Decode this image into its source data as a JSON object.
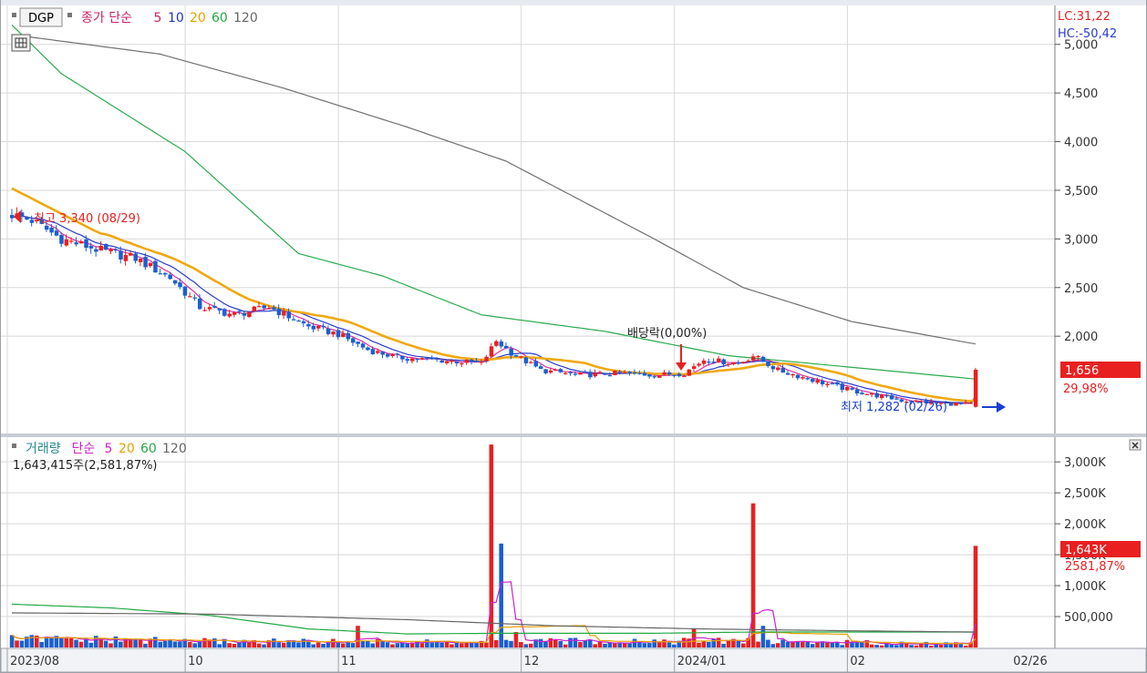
{
  "header": {
    "code": "DGP",
    "price_legend": [
      {
        "text": "종가 단순",
        "color": "#cc2266"
      },
      {
        "text": "5",
        "color": "#cc2266"
      },
      {
        "text": "10",
        "color": "#2233cc"
      },
      {
        "text": "20",
        "color": "#e8a000"
      },
      {
        "text": "60",
        "color": "#22aa44"
      },
      {
        "text": "120",
        "color": "#666666"
      }
    ],
    "lc": "LC:31,22",
    "hc": "HC:-50,42"
  },
  "volume_header": {
    "legend": [
      {
        "text": "거래량",
        "color": "#2a8a8a"
      },
      {
        "text": "단순",
        "color": "#cc22cc"
      },
      {
        "text": "5",
        "color": "#cc22cc"
      },
      {
        "text": "20",
        "color": "#e8a000"
      },
      {
        "text": "60",
        "color": "#22aa44"
      },
      {
        "text": "120",
        "color": "#666666"
      }
    ],
    "summary": "1,643,415주(2,581,87%)"
  },
  "annotations": {
    "high": "최고 3,340 (08/29)",
    "low": "최저 1,282 (02/26)",
    "ex_dividend": "배당락(0,00%)"
  },
  "badges": {
    "price": "1,656",
    "price_change": "29,98%",
    "volume": "1,643K",
    "volume_change": "2581,87%"
  },
  "colors": {
    "up": "#e82020",
    "down": "#1a5fd0",
    "ma5": "#e0309a",
    "ma10": "#2b3ccc",
    "ma20": "#f0a810",
    "ma60": "#2aaa50",
    "ma120": "#707070",
    "grid": "#d8d8d8",
    "badge": "#e82020"
  },
  "chart_data": [
    {
      "type": "candlestick",
      "title": "DGP",
      "y_ticks": [
        "5,000",
        "4,500",
        "4,000",
        "3,500",
        "3,000",
        "2,500",
        "2,000"
      ],
      "y_tick_values": [
        5000,
        4500,
        4000,
        3500,
        3000,
        2500,
        2000
      ],
      "ylim": [
        1000,
        5400
      ],
      "x_labels": [
        "2023/08",
        "10",
        "11",
        "12",
        "2024/01",
        "02",
        "02/26"
      ],
      "x_label_index": [
        0,
        36,
        67,
        104,
        135,
        170,
        203
      ],
      "n_bars": 195,
      "keypoints_close": [
        [
          0,
          3250
        ],
        [
          4,
          3190
        ],
        [
          10,
          3000
        ],
        [
          18,
          2880
        ],
        [
          25,
          2800
        ],
        [
          32,
          2600
        ],
        [
          38,
          2300
        ],
        [
          45,
          2220
        ],
        [
          52,
          2300
        ],
        [
          60,
          2100
        ],
        [
          66,
          2020
        ],
        [
          72,
          1860
        ],
        [
          78,
          1780
        ],
        [
          84,
          1760
        ],
        [
          90,
          1740
        ],
        [
          95,
          1720
        ],
        [
          98,
          1950
        ],
        [
          101,
          1830
        ],
        [
          107,
          1650
        ],
        [
          115,
          1600
        ],
        [
          123,
          1620
        ],
        [
          130,
          1600
        ],
        [
          136,
          1620
        ],
        [
          140,
          1760
        ],
        [
          147,
          1720
        ],
        [
          150,
          1800
        ],
        [
          155,
          1650
        ],
        [
          162,
          1550
        ],
        [
          170,
          1440
        ],
        [
          180,
          1340
        ],
        [
          188,
          1310
        ],
        [
          194,
          1300
        ]
      ],
      "last_bar": {
        "close": 1656,
        "prev_close": 1274
      },
      "high": {
        "value": 3340,
        "date": "08/29"
      },
      "low": {
        "value": 1282,
        "date": "02/26"
      },
      "moving_averages": [
        {
          "period": 5,
          "color": "#e0309a"
        },
        {
          "period": 10,
          "color": "#2b3ccc"
        },
        {
          "period": 20,
          "color": "#f0a810"
        },
        {
          "period": 60,
          "color": "#2aaa50",
          "keypoints": [
            [
              0,
              5200
            ],
            [
              10,
              4700
            ],
            [
              35,
              3900
            ],
            [
              58,
              2850
            ],
            [
              75,
              2620
            ],
            [
              95,
              2220
            ],
            [
              120,
              2050
            ],
            [
              145,
              1800
            ],
            [
              170,
              1680
            ],
            [
              195,
              1560
            ]
          ]
        },
        {
          "period": 120,
          "color": "#707070",
          "keypoints": [
            [
              0,
              5100
            ],
            [
              30,
              4900
            ],
            [
              55,
              4550
            ],
            [
              80,
              4150
            ],
            [
              100,
              3800
            ],
            [
              130,
              3000
            ],
            [
              148,
              2500
            ],
            [
              170,
              2150
            ],
            [
              195,
              1920
            ]
          ]
        }
      ]
    },
    {
      "type": "bar",
      "title": "거래량",
      "y_ticks": [
        "3,000K",
        "2,500K",
        "2,000K",
        "1,500K",
        "1,000K",
        "500,000"
      ],
      "y_tick_values": [
        3000,
        2500,
        2000,
        1500,
        1000,
        500
      ],
      "ylim": [
        0,
        3400
      ],
      "unit": "K",
      "keypoints_volume": [
        [
          0,
          140
        ],
        [
          20,
          120
        ],
        [
          40,
          100
        ],
        [
          70,
          90
        ],
        [
          95,
          80
        ],
        [
          120,
          110
        ],
        [
          150,
          100
        ],
        [
          180,
          70
        ],
        [
          194,
          60
        ]
      ],
      "spikes": [
        [
          70,
          350,
          "up"
        ],
        [
          97,
          3280,
          "up"
        ],
        [
          99,
          1680,
          "down"
        ],
        [
          102,
          250,
          "up"
        ],
        [
          138,
          300,
          "up"
        ],
        [
          150,
          2330,
          "up"
        ],
        [
          152,
          350,
          "down"
        ],
        [
          195,
          1643,
          "up"
        ]
      ],
      "moving_averages": [
        {
          "period": 5,
          "color": "#cc22cc"
        },
        {
          "period": 20,
          "color": "#e8a000"
        },
        {
          "period": 60,
          "color": "#22aa44",
          "keypoints": [
            [
              0,
              700
            ],
            [
              20,
              640
            ],
            [
              40,
              520
            ],
            [
              60,
              300
            ],
            [
              80,
              220
            ],
            [
              100,
              230
            ],
            [
              130,
              230
            ],
            [
              150,
              250
            ],
            [
              194,
              250
            ]
          ]
        },
        {
          "period": 120,
          "color": "#666666",
          "keypoints": [
            [
              0,
              560
            ],
            [
              40,
              540
            ],
            [
              80,
              450
            ],
            [
              110,
              350
            ],
            [
              140,
              300
            ],
            [
              170,
              270
            ],
            [
              194,
              250
            ]
          ]
        }
      ]
    }
  ]
}
